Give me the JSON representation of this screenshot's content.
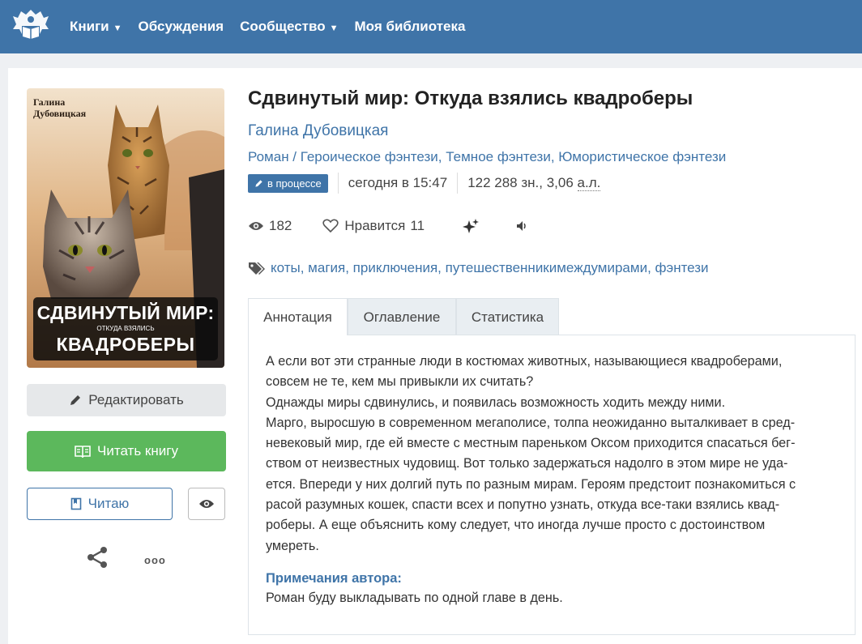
{
  "header": {
    "nav": [
      {
        "label": "Книги",
        "dropdown": true
      },
      {
        "label": "Обсуждения",
        "dropdown": false
      },
      {
        "label": "Сообщество",
        "dropdown": true
      },
      {
        "label": "Моя библиотека",
        "dropdown": false
      }
    ],
    "colors": {
      "bar": "#3f74a8"
    }
  },
  "cover": {
    "author_line1": "Галина",
    "author_line2": "Дубовицкая",
    "title_line1": "СДВИНУТЫЙ МИР:",
    "title_line2": "ОТКУДА ВЗЯЛИСЬ",
    "title_line3": "КВАДРОБЕРЫ"
  },
  "actions": {
    "edit_label": "Редактировать",
    "read_label": "Читать книгу",
    "reading_label": "Читаю",
    "more_label": "ooo"
  },
  "book": {
    "title": "Сдвинутый мир: Откуда взялись квадроберы",
    "author": "Галина Дубовицкая",
    "form": "Роман",
    "genres_sep": " / ",
    "genres": [
      "Героическое фэнтези",
      "Темное фэнтези",
      "Юмористическое фэнтези"
    ],
    "status_badge": "в процессе",
    "updated": "сегодня в 15:47",
    "size_chars": "122 288 зн., 3,06 ",
    "size_unit": "а.л.",
    "views": "182",
    "likes_label": "Нравится",
    "likes": "11",
    "tags": [
      "коты",
      "магия",
      "приключения",
      "путешественникимеждумирами",
      "фэнтези"
    ]
  },
  "tabs": [
    {
      "label": "Аннотация",
      "active": true
    },
    {
      "label": "Оглавление",
      "active": false
    },
    {
      "label": "Статистика",
      "active": false
    }
  ],
  "annotation": {
    "text": "А если вот эти странные люди в костюмах животных, называющиеся квадроберами,\nсовсем не те, кем мы привыкли их считать?\nОднажды миры сдвинулись, и появилась возможность ходить между ними.\nМарго, выросшую в современном мегаполисе, толпа неожиданно выталкивает в сред-\nневековый мир, где ей вместе с местным пареньком Оксом приходится спасаться бег-\nством от неизвестных чудовищ. Вот только задержаться надолго в этом мире не уда-\nется. Впереди у них долгий путь по разным мирам. Героям предстоит познакомиться с\nрасой разумных кошек, спасти всех и попутно узнать, откуда все-таки взялись квад-\nроберы. А еще объяснить кому следует, что иногда лучше просто с достоинством\nумереть.",
    "notes_heading": "Примечания автора:",
    "notes_text": "Роман буду выкладывать по одной главе в день."
  }
}
